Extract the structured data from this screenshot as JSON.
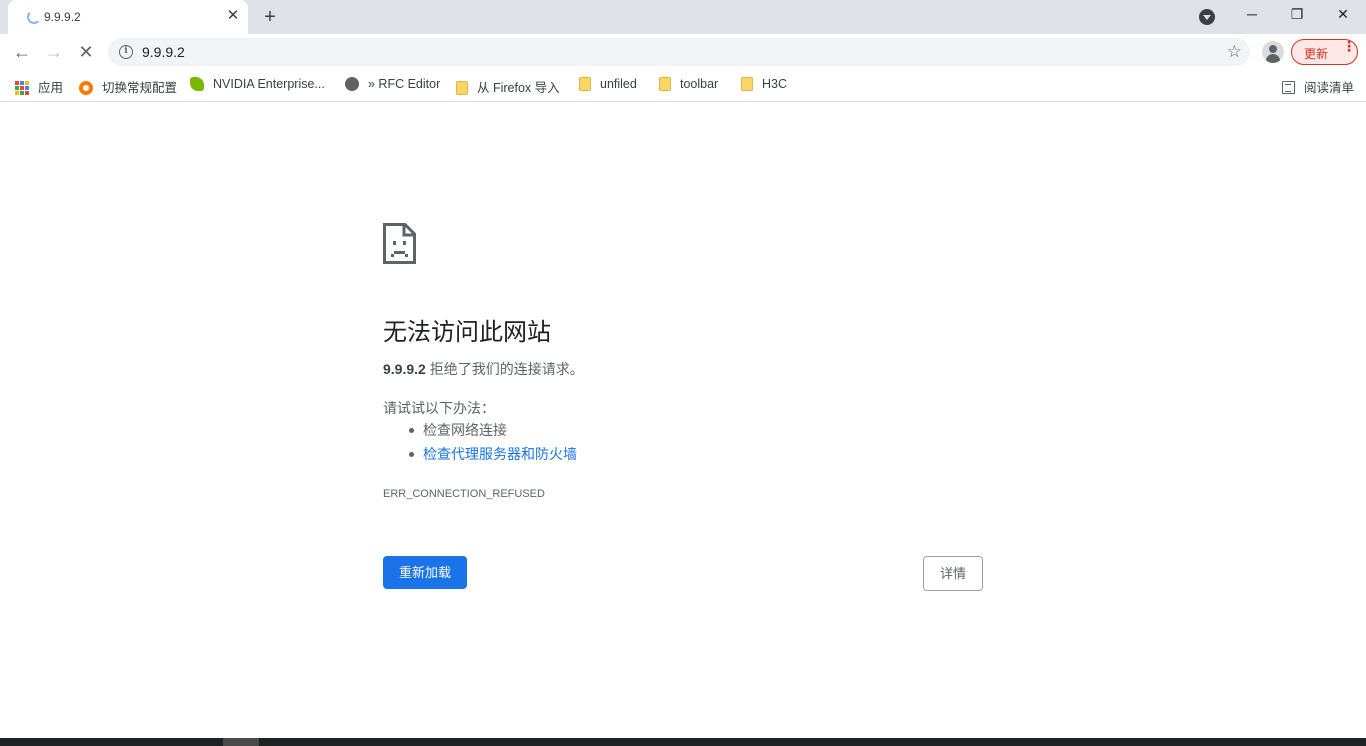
{
  "browser": {
    "tab": {
      "title": "9.9.9.2",
      "close_glyph": "✕"
    },
    "new_tab_glyph": "+",
    "window_controls": {
      "minimize": "─",
      "restore": "❐",
      "close": "✕"
    },
    "nav": {
      "back": "←",
      "forward": "→",
      "stop": "✕"
    },
    "omnibox": {
      "url": "9.9.9.2",
      "info_glyph": "i",
      "star_glyph": "☆"
    },
    "update_button": {
      "label": "更新",
      "menu_glyph": "⋮"
    }
  },
  "bookmarks": [
    {
      "label": "应用",
      "icon": "apps-icon"
    },
    {
      "label": "切换常规配置",
      "icon": "orange-circle-icon"
    },
    {
      "label": "NVIDIA Enterprise...",
      "icon": "nvidia-icon"
    },
    {
      "label": "» RFC Editor",
      "icon": "globe-icon"
    },
    {
      "label": "从 Firefox 导入",
      "icon": "folder-icon"
    },
    {
      "label": "unfiled",
      "icon": "folder-icon"
    },
    {
      "label": "toolbar",
      "icon": "folder-icon"
    },
    {
      "label": "H3C",
      "icon": "folder-icon"
    }
  ],
  "reading_list": {
    "label": "阅读清单",
    "icon": "reading-list-icon"
  },
  "error": {
    "heading": "无法访问此网站",
    "host": "9.9.9.2",
    "summary_tail": " 拒绝了我们的连接请求。",
    "suggestions_intro": "请试试以下办法：",
    "suggestions": [
      "检查网络连接",
      "检查代理服务器和防火墙"
    ],
    "code": "ERR_CONNECTION_REFUSED",
    "reload_label": "重新加载",
    "details_label": "详情"
  },
  "colors": {
    "accent": "#1a73e8",
    "update_red": "#d93025",
    "tabstrip": "#dee1e6"
  }
}
